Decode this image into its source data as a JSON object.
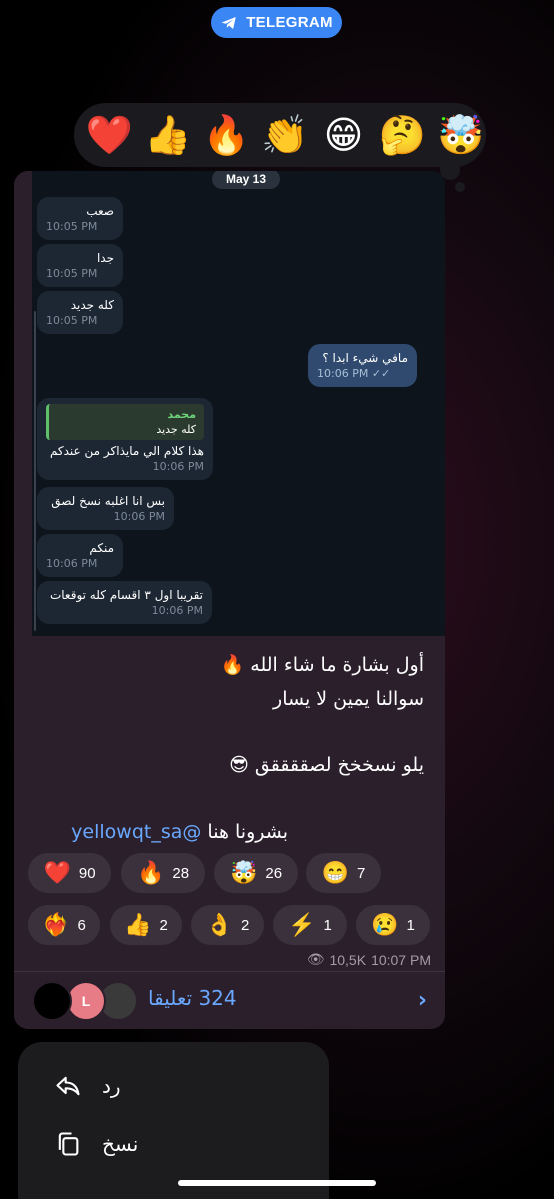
{
  "header": {
    "badge_label": "TELEGRAM"
  },
  "reaction_picker": [
    "❤️",
    "👍",
    "🔥",
    "👏",
    "😁",
    "🤔",
    "🤯"
  ],
  "screenshot": {
    "date": "May 13",
    "messages": [
      {
        "text": "صعب",
        "time": "10:05 PM",
        "out": false
      },
      {
        "text": "جدا",
        "time": "10:05 PM",
        "out": false
      },
      {
        "text": "كله جديد",
        "time": "10:05 PM",
        "out": false
      },
      {
        "text": "مافي شيء ابدا ؟",
        "time": "10:06 PM",
        "out": true
      },
      {
        "reply_name": "محمد",
        "reply_text": "كله جديد",
        "text": "هذا كلام الي مايذاكر من عندكم",
        "time": "10:06 PM",
        "out": false
      },
      {
        "text": "بس انا اغلبه نسخ لصق",
        "time": "10:06 PM",
        "out": false
      },
      {
        "text": "منكم",
        "time": "10:06 PM",
        "out": false
      },
      {
        "text": "تقريبا اول ٣ اقسام كله توقعات",
        "time": "10:06 PM",
        "out": false
      }
    ]
  },
  "caption": {
    "line1": "أول بشارة ما شاء الله 🔥",
    "line2": "سوالنا يمين لا يسار",
    "line3": "يلو نسخخخ لصققققق 😎",
    "line4_text": "بشرونا هنا ",
    "line4_link": "@yellowqt_sa"
  },
  "reactions": [
    {
      "emoji": "❤️",
      "count": "90"
    },
    {
      "emoji": "🔥",
      "count": "28"
    },
    {
      "emoji": "🤯",
      "count": "26"
    },
    {
      "emoji": "😁",
      "count": "7"
    },
    {
      "emoji": "❤️‍🔥",
      "count": "6"
    },
    {
      "emoji": "👍",
      "count": "2"
    },
    {
      "emoji": "👌",
      "count": "2"
    },
    {
      "emoji": "⚡",
      "count": "1"
    },
    {
      "emoji": "😢",
      "count": "1"
    }
  ],
  "post_meta": {
    "views": "10,5K",
    "time": "10:07 PM"
  },
  "comments": {
    "label": "324 تعليقا",
    "avatar_initial": "L"
  },
  "context_menu": [
    {
      "label": "رد",
      "icon": "reply-icon"
    },
    {
      "label": "نسخ",
      "icon": "copy-icon"
    }
  ]
}
